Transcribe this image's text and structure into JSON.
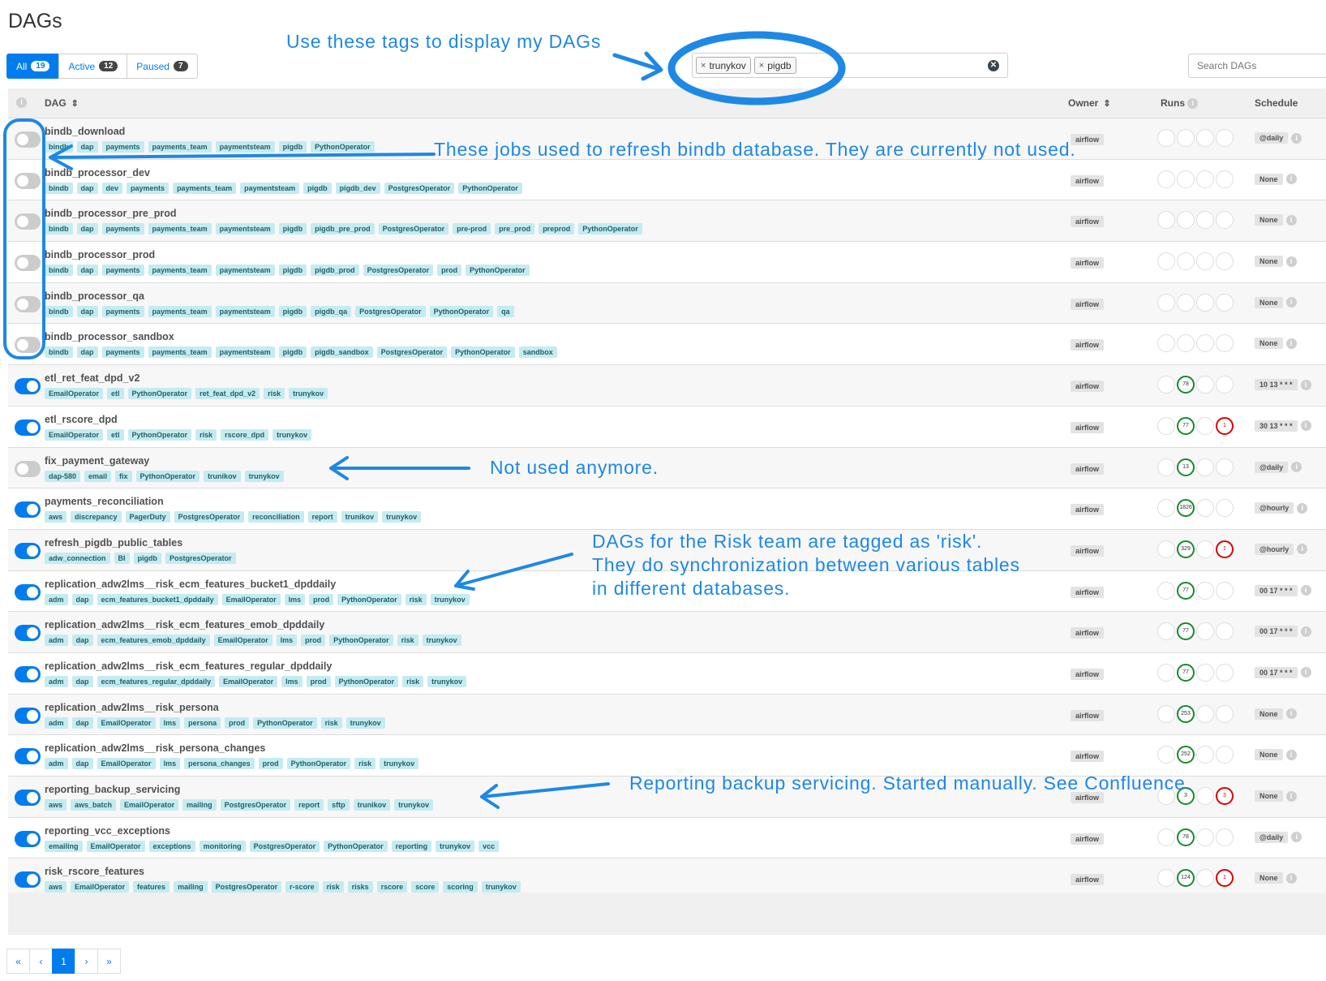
{
  "page_title": "DAGs",
  "filters": [
    {
      "label": "All",
      "count": "19"
    },
    {
      "label": "Active",
      "count": "12"
    },
    {
      "label": "Paused",
      "count": "7"
    }
  ],
  "tag_filter": {
    "tags": [
      "trunykov",
      "pigdb"
    ]
  },
  "search": {
    "placeholder": "Search DAGs"
  },
  "table": {
    "headers": {
      "dag": "DAG",
      "owner": "Owner",
      "runs": "Runs",
      "schedule": "Schedule"
    }
  },
  "dags": [
    {
      "name": "bindb_download",
      "active": false,
      "tags": [
        "bindb",
        "dap",
        "payments",
        "payments_team",
        "paymentsteam",
        "pigdb",
        "PythonOperator"
      ],
      "owner": "airflow",
      "runs": [
        "",
        "",
        "",
        ""
      ],
      "schedule": "@daily"
    },
    {
      "name": "bindb_processor_dev",
      "active": false,
      "tags": [
        "bindb",
        "dap",
        "dev",
        "payments",
        "payments_team",
        "paymentsteam",
        "pigdb",
        "pigdb_dev",
        "PostgresOperator",
        "PythonOperator"
      ],
      "owner": "airflow",
      "runs": [
        "",
        "",
        "",
        ""
      ],
      "schedule": "None"
    },
    {
      "name": "bindb_processor_pre_prod",
      "active": false,
      "tags": [
        "bindb",
        "dap",
        "payments",
        "payments_team",
        "paymentsteam",
        "pigdb",
        "pigdb_pre_prod",
        "PostgresOperator",
        "pre-prod",
        "pre_prod",
        "preprod",
        "PythonOperator"
      ],
      "owner": "airflow",
      "runs": [
        "",
        "",
        "",
        ""
      ],
      "schedule": "None"
    },
    {
      "name": "bindb_processor_prod",
      "active": false,
      "tags": [
        "bindb",
        "dap",
        "payments",
        "payments_team",
        "paymentsteam",
        "pigdb",
        "pigdb_prod",
        "PostgresOperator",
        "prod",
        "PythonOperator"
      ],
      "owner": "airflow",
      "runs": [
        "",
        "",
        "",
        ""
      ],
      "schedule": "None"
    },
    {
      "name": "bindb_processor_qa",
      "active": false,
      "tags": [
        "bindb",
        "dap",
        "payments",
        "payments_team",
        "paymentsteam",
        "pigdb",
        "pigdb_qa",
        "PostgresOperator",
        "PythonOperator",
        "qa"
      ],
      "owner": "airflow",
      "runs": [
        "",
        "",
        "",
        ""
      ],
      "schedule": "None"
    },
    {
      "name": "bindb_processor_sandbox",
      "active": false,
      "tags": [
        "bindb",
        "dap",
        "payments",
        "payments_team",
        "paymentsteam",
        "pigdb",
        "pigdb_sandbox",
        "PostgresOperator",
        "PythonOperator",
        "sandbox"
      ],
      "owner": "airflow",
      "runs": [
        "",
        "",
        "",
        ""
      ],
      "schedule": "None"
    },
    {
      "name": "etl_ret_feat_dpd_v2",
      "active": true,
      "tags": [
        "EmailOperator",
        "etl",
        "PythonOperator",
        "ret_feat_dpd_v2",
        "risk",
        "trunykov"
      ],
      "owner": "airflow",
      "runs": [
        "",
        "s:78",
        "",
        ""
      ],
      "schedule": "10 13 * * *"
    },
    {
      "name": "etl_rscore_dpd",
      "active": true,
      "tags": [
        "EmailOperator",
        "etl",
        "PythonOperator",
        "risk",
        "rscore_dpd",
        "trunykov"
      ],
      "owner": "airflow",
      "runs": [
        "",
        "s:77",
        "",
        "f:1"
      ],
      "schedule": "30 13 * * *"
    },
    {
      "name": "fix_payment_gateway",
      "active": false,
      "tags": [
        "dap-580",
        "email",
        "fix",
        "PythonOperator",
        "trunikov",
        "trunykov"
      ],
      "owner": "airflow",
      "runs": [
        "",
        "s:13",
        "",
        ""
      ],
      "schedule": "@daily"
    },
    {
      "name": "payments_reconciliation",
      "active": true,
      "tags": [
        "aws",
        "discrepancy",
        "PagerDuty",
        "PostgresOperator",
        "reconciliation",
        "report",
        "trunikov",
        "trunykov"
      ],
      "owner": "airflow",
      "runs": [
        "",
        "s:1826",
        "",
        ""
      ],
      "schedule": "@hourly"
    },
    {
      "name": "refresh_pigdb_public_tables",
      "active": true,
      "tags": [
        "adw_connection",
        "BI",
        "pigdb",
        "PostgresOperator"
      ],
      "owner": "airflow",
      "runs": [
        "",
        "s:329",
        "",
        "f:1"
      ],
      "schedule": "@hourly"
    },
    {
      "name": "replication_adw2lms__risk_ecm_features_bucket1_dpddaily",
      "active": true,
      "tags": [
        "adm",
        "dap",
        "ecm_features_bucket1_dpddaily",
        "EmailOperator",
        "lms",
        "prod",
        "PythonOperator",
        "risk",
        "trunykov"
      ],
      "owner": "airflow",
      "runs": [
        "",
        "s:77",
        "",
        ""
      ],
      "schedule": "00 17 * * *"
    },
    {
      "name": "replication_adw2lms__risk_ecm_features_emob_dpddaily",
      "active": true,
      "tags": [
        "adm",
        "dap",
        "ecm_features_emob_dpddaily",
        "EmailOperator",
        "lms",
        "prod",
        "PythonOperator",
        "risk",
        "trunykov"
      ],
      "owner": "airflow",
      "runs": [
        "",
        "s:77",
        "",
        ""
      ],
      "schedule": "00 17 * * *"
    },
    {
      "name": "replication_adw2lms__risk_ecm_features_regular_dpddaily",
      "active": true,
      "tags": [
        "adm",
        "dap",
        "ecm_features_regular_dpddaily",
        "EmailOperator",
        "lms",
        "prod",
        "PythonOperator",
        "risk",
        "trunykov"
      ],
      "owner": "airflow",
      "runs": [
        "",
        "s:77",
        "",
        ""
      ],
      "schedule": "00 17 * * *"
    },
    {
      "name": "replication_adw2lms__risk_persona",
      "active": true,
      "tags": [
        "adm",
        "dap",
        "EmailOperator",
        "lms",
        "persona",
        "prod",
        "PythonOperator",
        "risk",
        "trunykov"
      ],
      "owner": "airflow",
      "runs": [
        "",
        "s:253",
        "",
        ""
      ],
      "schedule": "None"
    },
    {
      "name": "replication_adw2lms__risk_persona_changes",
      "active": true,
      "tags": [
        "adm",
        "dap",
        "EmailOperator",
        "lms",
        "persona_changes",
        "prod",
        "PythonOperator",
        "risk",
        "trunykov"
      ],
      "owner": "airflow",
      "runs": [
        "",
        "s:252",
        "",
        ""
      ],
      "schedule": "None"
    },
    {
      "name": "reporting_backup_servicing",
      "active": true,
      "tags": [
        "aws",
        "aws_batch",
        "EmailOperator",
        "mailing",
        "PostgresOperator",
        "report",
        "sftp",
        "trunikov",
        "trunykov"
      ],
      "owner": "airflow",
      "runs": [
        "",
        "s:3",
        "",
        "f:3"
      ],
      "schedule": "None"
    },
    {
      "name": "reporting_vcc_exceptions",
      "active": true,
      "tags": [
        "emailing",
        "EmailOperator",
        "exceptions",
        "monitoring",
        "PostgresOperator",
        "PythonOperator",
        "reporting",
        "trunykov",
        "vcc"
      ],
      "owner": "airflow",
      "runs": [
        "",
        "s:78",
        "",
        ""
      ],
      "schedule": "@daily"
    },
    {
      "name": "risk_rscore_features",
      "active": true,
      "tags": [
        "aws",
        "EmailOperator",
        "features",
        "mailing",
        "PostgresOperator",
        "r-score",
        "risk",
        "risks",
        "rscore",
        "score",
        "scoring",
        "trunykov"
      ],
      "owner": "airflow",
      "runs": [
        "",
        "s:124",
        "",
        "f:1"
      ],
      "schedule": "None"
    }
  ],
  "pagination": {
    "first": "«",
    "prev": "‹",
    "current": "1",
    "next": "›",
    "last": "»"
  },
  "annotations": {
    "tags_note": "Use these tags to display my DAGs",
    "bindb_note": "These jobs used to refresh bindb database. They are currently not used.",
    "fix_note": "Not used anymore.",
    "risk_note_1": "DAGs for the Risk team are tagged as 'risk'.",
    "risk_note_2": "They do synchronization between various tables",
    "risk_note_3": "in different databases.",
    "reporting_note": "Reporting backup servicing. Started manually. See Confluence.",
    "color": "#1e88e5"
  }
}
